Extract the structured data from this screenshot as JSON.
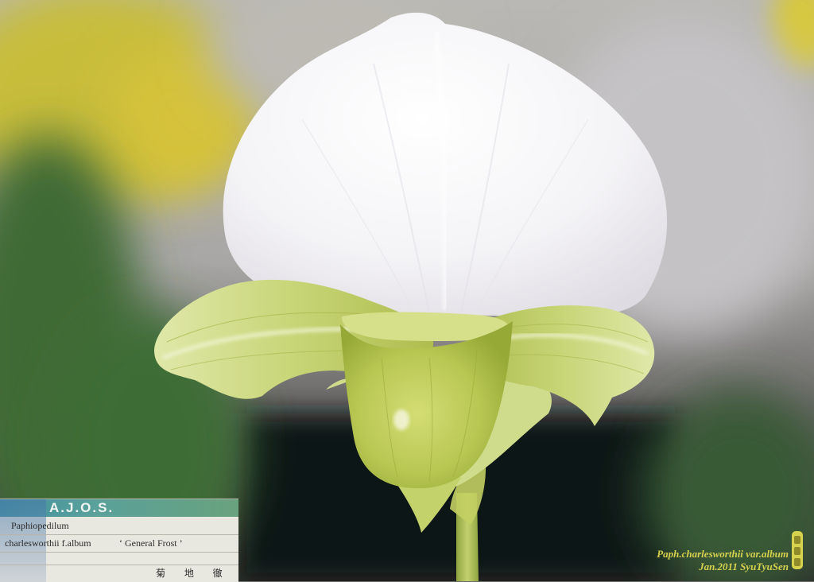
{
  "photo": {
    "subject": "orchid-flower"
  },
  "tag": {
    "header": "A.J.O.S.",
    "genus": "Paphiopedilum",
    "species": "charlesworthii f.album",
    "cultivar": "‘ General Frost ’",
    "owner": "菊 地 徹"
  },
  "caption": {
    "line1": "Paph.charlesworthii var.album",
    "line2": "Jan.2011  SyuTyuSen"
  },
  "colors": {
    "petal_white": "#f4f3f6",
    "lip_green": "#c6d46a",
    "caption_yellow": "#d6d24e"
  }
}
